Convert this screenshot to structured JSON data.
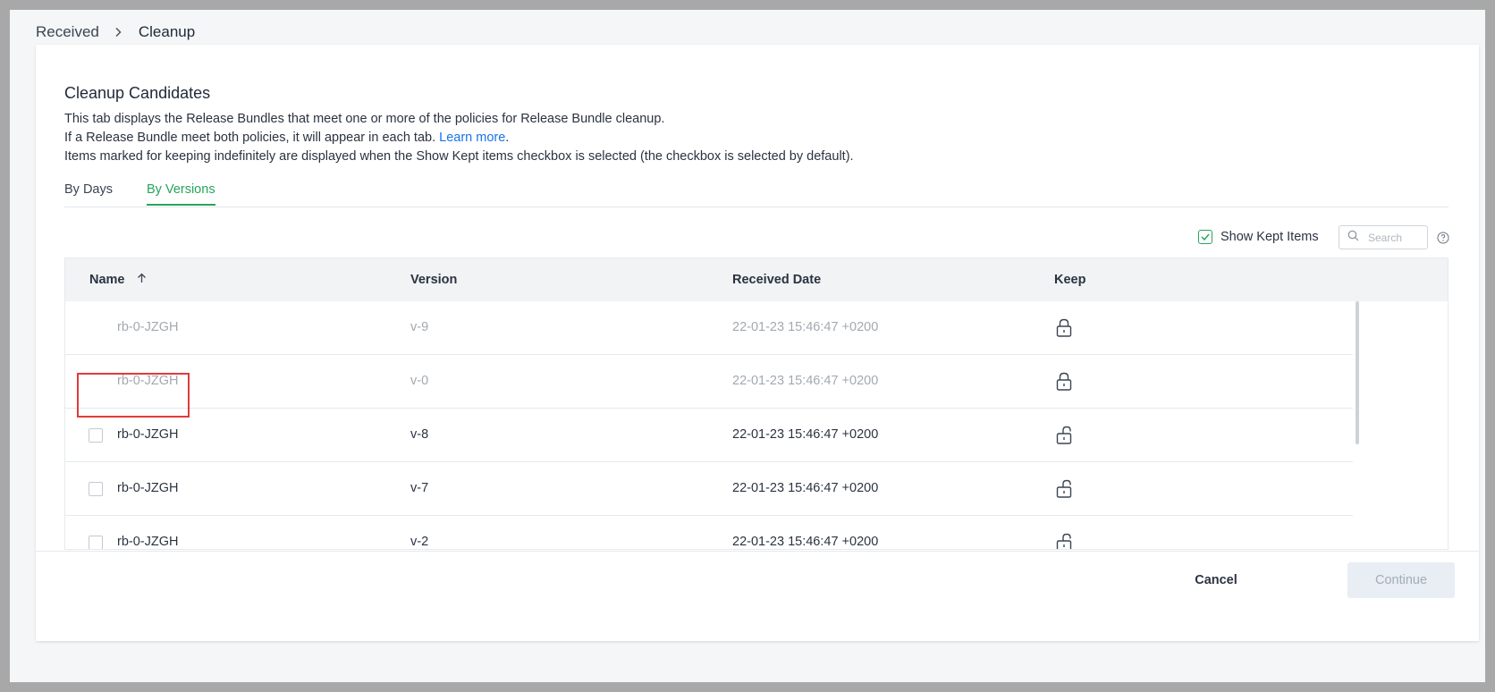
{
  "breadcrumb": {
    "parent": "Received",
    "current": "Cleanup"
  },
  "panel": {
    "title": "Cleanup Candidates",
    "description": {
      "line1": "This tab displays the Release Bundles that meet one or more of the policies for Release Bundle cleanup.",
      "line2_prefix": "If a Release Bundle meet both policies, it will appear in each tab. ",
      "learn_more": "Learn more",
      "line2_suffix": ".",
      "line3": "Items marked for keeping indefinitely are displayed when the Show Kept items checkbox is selected (the checkbox is selected by default)."
    }
  },
  "tabs": [
    {
      "label": "By Days",
      "active": false
    },
    {
      "label": "By Versions",
      "active": true
    }
  ],
  "toolbar": {
    "show_kept_label": "Show Kept Items",
    "show_kept_checked": true,
    "search_placeholder": "Search"
  },
  "table": {
    "columns": {
      "name": "Name",
      "version": "Version",
      "received_date": "Received Date",
      "keep": "Keep"
    },
    "sort": {
      "column": "name",
      "direction": "asc"
    },
    "rows": [
      {
        "name": "rb-0-JZGH",
        "version": "v-9",
        "received_date": "22-01-23 15:46:47 +0200",
        "kept": true
      },
      {
        "name": "rb-0-JZGH",
        "version": "v-0",
        "received_date": "22-01-23 15:46:47 +0200",
        "kept": true
      },
      {
        "name": "rb-0-JZGH",
        "version": "v-8",
        "received_date": "22-01-23 15:46:47 +0200",
        "kept": false
      },
      {
        "name": "rb-0-JZGH",
        "version": "v-7",
        "received_date": "22-01-23 15:46:47 +0200",
        "kept": false
      },
      {
        "name": "rb-0-JZGH",
        "version": "v-2",
        "received_date": "22-01-23 15:46:47 +0200",
        "kept": false
      }
    ]
  },
  "footer": {
    "cancel_label": "Cancel",
    "continue_label": "Continue",
    "continue_disabled": true
  },
  "colors": {
    "accent": "#26a55b",
    "link": "#1a73e8",
    "highlight": "#e03b3b"
  }
}
